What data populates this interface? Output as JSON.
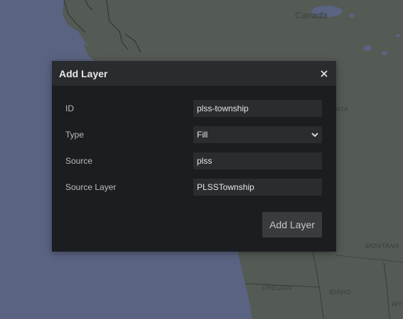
{
  "map": {
    "labels": {
      "canada": "Canada",
      "montana": "MONTANA",
      "oregon": "OREGON",
      "idaho": "IDAHO",
      "wyo": "WYO",
      "alta": "RTA"
    },
    "colors": {
      "land": "#545a54",
      "water": "#5a6381",
      "border": "#2f3230"
    }
  },
  "modal": {
    "title": "Add Layer",
    "close_icon": "close-icon",
    "fields": {
      "id": {
        "label": "ID",
        "value": "plss-township"
      },
      "type": {
        "label": "Type",
        "value": "Fill",
        "icon": "chevron-down-icon"
      },
      "source": {
        "label": "Source",
        "value": "plss"
      },
      "source_layer": {
        "label": "Source Layer",
        "value": "PLSSTownship"
      }
    },
    "submit_label": "Add Layer"
  }
}
